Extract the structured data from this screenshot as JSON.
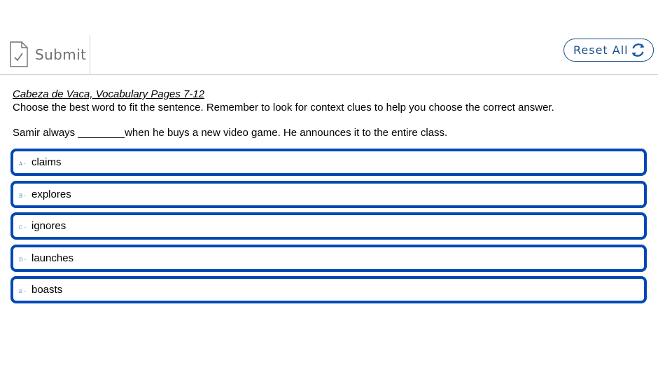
{
  "toolbar": {
    "submit_label": "Submit",
    "submit_icon": "document-check-icon",
    "reset_label": "Reset All",
    "reset_icon": "refresh-icon"
  },
  "content": {
    "title": "Cabeza de Vaca, Vocabulary Pages 7-12",
    "instructions": "Choose the best word to fit the sentence. Remember to look for context clues to help you choose the correct answer.",
    "question": "Samir always ________when he buys a new video game. He announces it to the entire class."
  },
  "choices": [
    {
      "letter": "A -",
      "text": "claims"
    },
    {
      "letter": "B -",
      "text": "explores"
    },
    {
      "letter": "C -",
      "text": "ignores"
    },
    {
      "letter": "D -",
      "text": "launches"
    },
    {
      "letter": "E -",
      "text": "boasts"
    }
  ],
  "colors": {
    "choice_border": "#0049b5",
    "reset_border": "#1a4f88",
    "submit_text": "#6f6f6f"
  }
}
